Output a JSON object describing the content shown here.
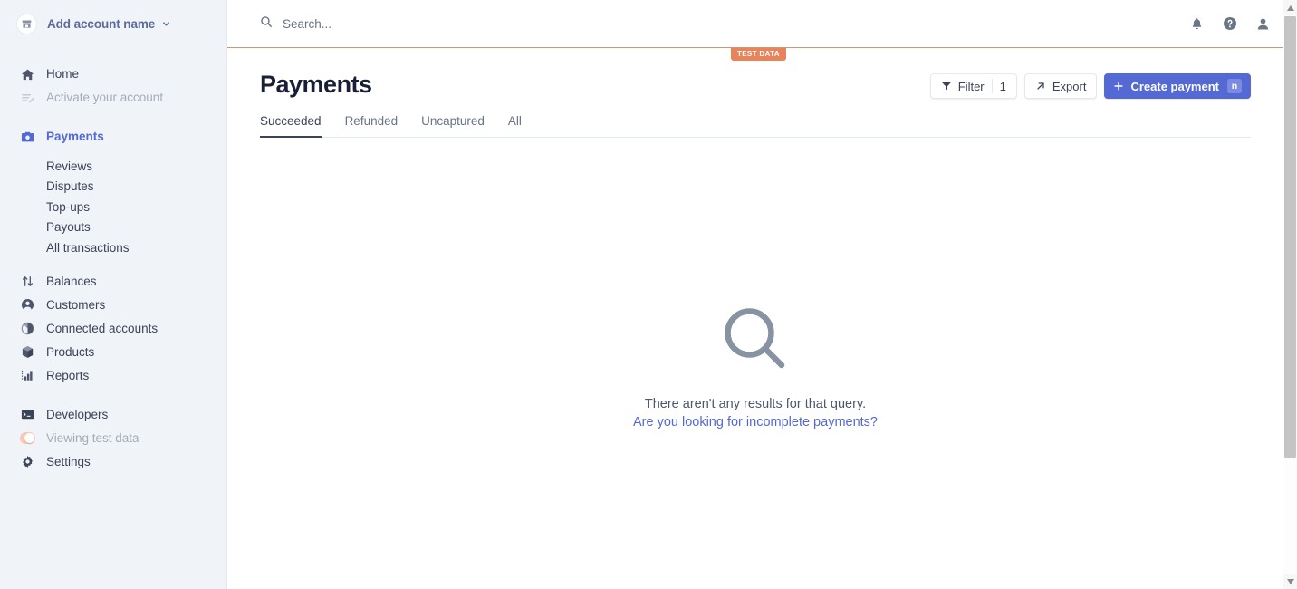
{
  "sidebar": {
    "account": {
      "name": "Add account name",
      "avatar_icon": "store-icon",
      "caret_icon": "chevron-down-icon"
    },
    "items": [
      {
        "label": "Home",
        "icon": "home-icon",
        "state": "normal"
      },
      {
        "label": "Activate your account",
        "icon": "activate-icon",
        "state": "muted"
      },
      {
        "label": "Payments",
        "icon": "payments-icon",
        "state": "active"
      },
      {
        "label": "Balances",
        "icon": "balances-icon",
        "state": "normal"
      },
      {
        "label": "Customers",
        "icon": "customers-icon",
        "state": "normal"
      },
      {
        "label": "Connected accounts",
        "icon": "connected-accounts-icon",
        "state": "normal"
      },
      {
        "label": "Products",
        "icon": "products-icon",
        "state": "normal"
      },
      {
        "label": "Reports",
        "icon": "reports-icon",
        "state": "normal"
      },
      {
        "label": "Developers",
        "icon": "developers-icon",
        "state": "normal"
      },
      {
        "label": "Viewing test data",
        "icon": "toggle-icon",
        "state": "muted"
      },
      {
        "label": "Settings",
        "icon": "settings-gear-icon",
        "state": "normal"
      }
    ],
    "sub_items": [
      {
        "label": "Reviews"
      },
      {
        "label": "Disputes"
      },
      {
        "label": "Top-ups"
      },
      {
        "label": "Payouts"
      },
      {
        "label": "All transactions"
      }
    ]
  },
  "topbar": {
    "search": {
      "placeholder": "Search...",
      "value": "",
      "icon": "search-icon"
    },
    "icons": [
      {
        "name": "notifications-bell-icon"
      },
      {
        "name": "help-circle-icon"
      },
      {
        "name": "user-account-icon"
      }
    ]
  },
  "test_banner": {
    "label": "TEST DATA",
    "color": "#e8835a",
    "line_color": "#c89a7c"
  },
  "page": {
    "title": "Payments",
    "tabs": [
      {
        "label": "Succeeded",
        "active": true
      },
      {
        "label": "Refunded",
        "active": false
      },
      {
        "label": "Uncaptured",
        "active": false
      },
      {
        "label": "All",
        "active": false
      }
    ],
    "actions": {
      "filter_label": "Filter",
      "filter_count": "1",
      "filter_icon": "funnel-icon",
      "export_label": "Export",
      "export_icon": "arrow-up-right-icon",
      "create_label": "Create payment",
      "create_icon": "plus-icon",
      "create_shortcut": "n",
      "primary_color": "#5469d4"
    },
    "empty_state": {
      "icon": "magnifier-icon",
      "title": "There aren't any results for that query.",
      "link": "Are you looking for incomplete payments?"
    }
  },
  "scrollbar": {
    "up_arrow_icon": "triangle-up-icon",
    "down_arrow_icon": "triangle-down-icon"
  }
}
